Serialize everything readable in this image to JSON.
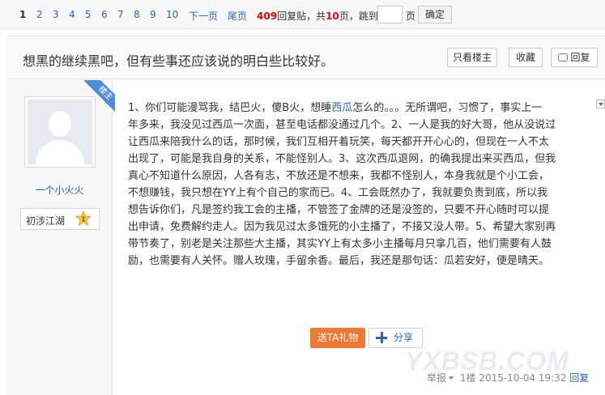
{
  "pager": {
    "pages": [
      "1",
      "2",
      "3",
      "4",
      "5",
      "6",
      "7",
      "8",
      "9",
      "10"
    ],
    "next": "下一页",
    "last": "尾页",
    "reply_count": "409",
    "reply_label": "回复贴，共",
    "page_total": "10",
    "page_total_label": "页，跳到",
    "jump_unit": "页",
    "confirm": "确定"
  },
  "thread": {
    "title": "想黑的继续黑吧，但有些事还应该说的明白些比较好。",
    "only_op": "只看楼主",
    "favorite": "收藏",
    "reply": "回复"
  },
  "author": {
    "badge": "楼主",
    "name": "一个小火火",
    "level_name": "初涉江湖",
    "level_num": "1"
  },
  "post": {
    "lines": [
      [
        "1、你们可能漫骂我，结巴火，傻B火，想睡",
        "西瓜",
        "怎么的。。。无所谓吧，习惯了，事实上一"
      ],
      [
        "年多来，我没见过西瓜一次面，甚至电话都没通过几个。2、一人是我的好大哥，他从没说过"
      ],
      [
        "让西瓜来陪我什么的话，那时候，我们互相开着玩笑，每天都开开心心的，但现在一人不太"
      ],
      [
        "出现了，可能是我自身的关系，不能怪别人。3、这次西瓜退网，的确我提出来买西瓜，但我"
      ],
      [
        "真心不知道什么原因，人各有志，不放还是不想来，我都不怪别人，本身我就是个小工会，"
      ],
      [
        "不想赚钱，我只想在YY上有个自己的家而已。4、工会既然办了，我就要负责到底，所以我"
      ],
      [
        "想告诉你们，凡是签约我工会的主播，不管签了金牌的还是没签的，只要不开心随时可以提"
      ],
      [
        "出申请，免费解约走人。因为我见过太多饿死的小主播了，不接又没人带。5、希望大家别再"
      ],
      [
        "带节奏了，别老是关注那些大主播，其实YY上有太多小主播每月只拿几百，他们需要有人鼓"
      ],
      [
        "励，也需要有人关怀。赠人玫瑰，手留余香。最后，我还是那句话：瓜若安好，便是晴天。"
      ]
    ],
    "gift": "送TA礼物",
    "share": "分享"
  },
  "footer": {
    "report": "举报",
    "floor": "1楼",
    "datetime": "2015-10-04 19:32",
    "reply": "回复"
  },
  "watermark": "YXBSB.COM",
  "colors": {
    "link": "#2d64b3",
    "highlight": "#e10602",
    "gift_button": "#f07830",
    "badge_band": "#4d8ed8"
  },
  "icons": [
    "reply-icon",
    "collapse-arrow-icon",
    "default-avatar-icon",
    "level-star-icon",
    "plus-icon",
    "dropdown-icon"
  ]
}
